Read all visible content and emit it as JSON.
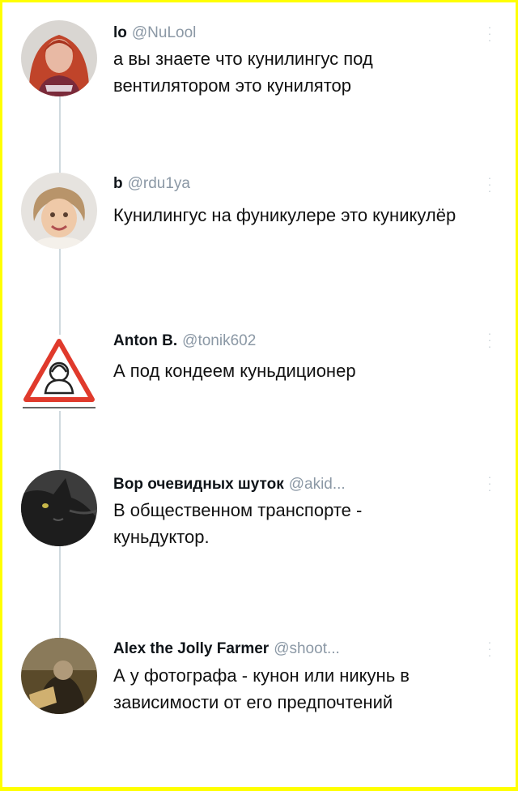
{
  "tweets": [
    {
      "name": "lo",
      "handle": "@NuLool",
      "text": "а вы знаете что кунилингус под вентилятором это кунилятор",
      "avatar_icon": "girl-red-hair-avatar-icon"
    },
    {
      "name": "b",
      "handle": "@rdu1ya",
      "text": "Кунилингус на фуникулере это куникулёр",
      "avatar_icon": "child-photo-avatar-icon"
    },
    {
      "name": "Anton B.",
      "handle": "@tonik602",
      "text": "А под кондеем куньдиционер",
      "avatar_icon": "warning-sign-avatar-icon"
    },
    {
      "name": "Вор очевидных шуток",
      "handle": "@akid...",
      "text": "В общественном транспорте - куньдуктор.",
      "avatar_icon": "black-cat-avatar-icon"
    },
    {
      "name": "Alex the Jolly Farmer",
      "handle": "@shoot...",
      "text": "А у фотографа - кунон или никунь в зависимости от его предпочтений",
      "avatar_icon": "photo-dark-avatar-icon"
    }
  ],
  "more_icon": "more-options-icon",
  "colors": {
    "border": "#ffff00",
    "handle": "#8b98a5",
    "thread_line": "#cfd9de"
  }
}
